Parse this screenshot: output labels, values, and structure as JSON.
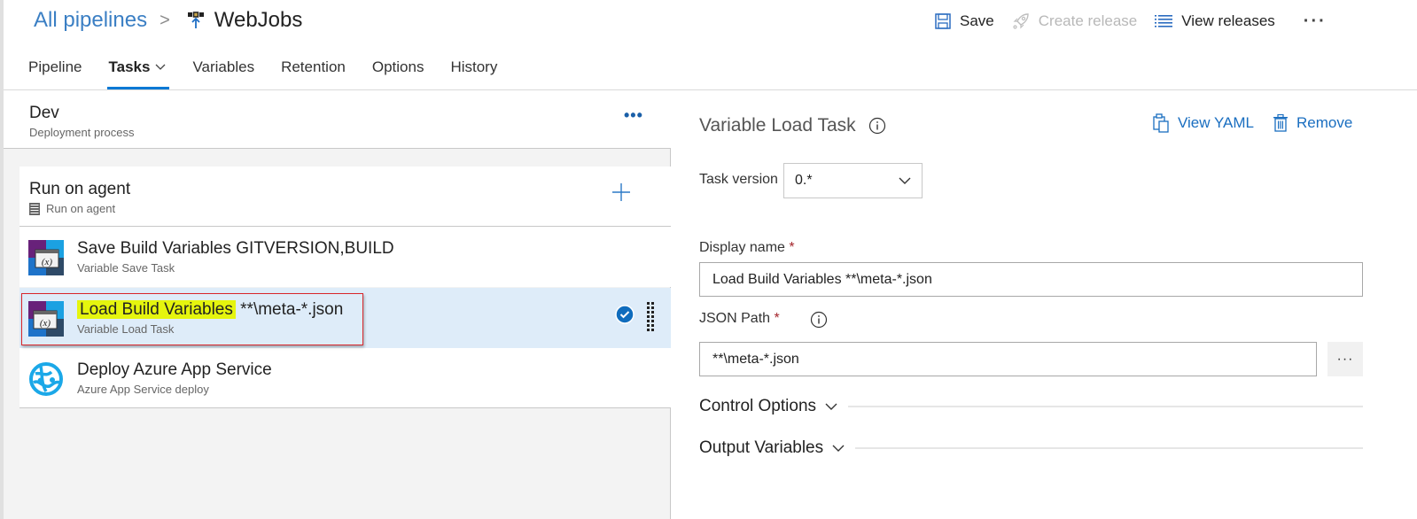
{
  "header": {
    "breadcrumb_root": "All pipelines",
    "breadcrumb_sep": ">",
    "pipeline_name": "WebJobs",
    "pipeline_icon": "release-pipeline-icon"
  },
  "toolbar": {
    "save_label": "Save",
    "create_release_label": "Create release",
    "view_releases_label": "View releases",
    "more_label": "···"
  },
  "tabs": [
    {
      "label": "Pipeline",
      "active": false
    },
    {
      "label": "Tasks",
      "active": true,
      "has_dropdown": true
    },
    {
      "label": "Variables",
      "active": false
    },
    {
      "label": "Retention",
      "active": false
    },
    {
      "label": "Options",
      "active": false
    },
    {
      "label": "History",
      "active": false
    }
  ],
  "stage": {
    "name": "Dev",
    "subtitle": "Deployment process",
    "more_label": "•••"
  },
  "job": {
    "name": "Run on agent",
    "subtitle": "Run on agent"
  },
  "tasks": [
    {
      "name": "Save Build Variables GITVERSION,BUILD",
      "type": "Variable Save Task",
      "icon": "variable-task-icon",
      "selected": false
    },
    {
      "name_highlight": "Load Build Variables",
      "name_rest": " **\\meta-*.json",
      "type": "Variable Load Task",
      "icon": "variable-task-icon",
      "selected": true
    },
    {
      "name": "Deploy Azure App Service",
      "type": "Azure App Service deploy",
      "icon": "azure-app-service-icon",
      "selected": false
    }
  ],
  "detail": {
    "title": "Variable Load Task",
    "view_yaml_label": "View YAML",
    "remove_label": "Remove",
    "task_version_label": "Task version",
    "task_version_value": "0.*",
    "display_name_label": "Display name",
    "display_name_value": "Load Build Variables **\\meta-*.json",
    "json_path_label": "JSON Path",
    "json_path_value": "**\\meta-*.json",
    "required_mark": "*",
    "browse_label": "···",
    "sections": [
      {
        "label": "Control Options"
      },
      {
        "label": "Output Variables"
      }
    ]
  },
  "colors": {
    "accent": "#0078d4",
    "link": "#1a6ec0",
    "selected_row": "#deecf9",
    "highlight": "#e5f50e",
    "annotation_border": "#d9262b"
  }
}
